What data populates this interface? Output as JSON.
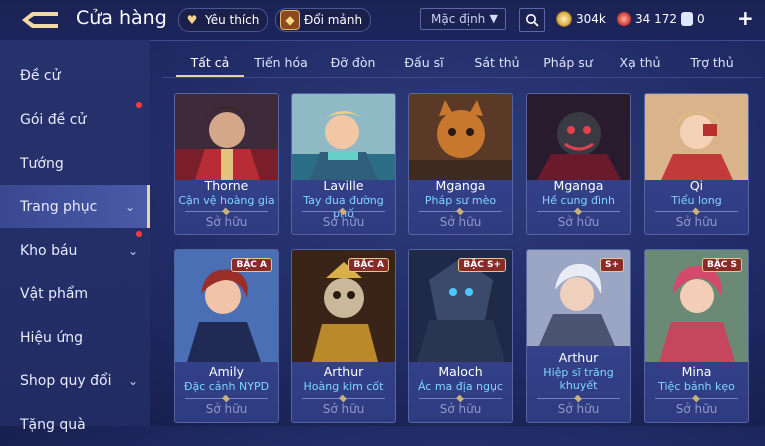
{
  "header": {
    "title": "Cửa hàng",
    "favorites_label": "Yêu thích",
    "exchange_label": "Đổi mảnh",
    "sort_label": "Mặc định",
    "gold": "304k",
    "gems": "34 172",
    "vouchers": "0",
    "plus": "+"
  },
  "sidebar": {
    "items": [
      {
        "label": "Đề cử"
      },
      {
        "label": "Gói đề cử"
      },
      {
        "label": "Tướng"
      },
      {
        "label": "Trang phục"
      },
      {
        "label": "Kho báu"
      },
      {
        "label": "Vật phẩm"
      },
      {
        "label": "Hiệu ứng"
      },
      {
        "label": "Shop quy đổi"
      },
      {
        "label": "Tặng quà"
      }
    ]
  },
  "tabs": [
    "Tất cả",
    "Tiến hóa",
    "Đỡ đòn",
    "Đấu sĩ",
    "Sát thủ",
    "Pháp sư",
    "Xạ thủ",
    "Trợ thủ"
  ],
  "cards": [
    {
      "name": "Thorne",
      "skin": "Cận vệ hoàng gia",
      "status": "Sở hữu",
      "badge": ""
    },
    {
      "name": "Laville",
      "skin": "Tay đua đường phố",
      "status": "Sở hữu",
      "badge": ""
    },
    {
      "name": "Mganga",
      "skin": "Pháp sư mèo",
      "status": "Sở hữu",
      "badge": ""
    },
    {
      "name": "Mganga",
      "skin": "Hề cung đình",
      "status": "Sở hữu",
      "badge": ""
    },
    {
      "name": "Qi",
      "skin": "Tiểu long",
      "status": "Sở hữu",
      "badge": ""
    },
    {
      "name": "Amily",
      "skin": "Đặc cảnh NYPD",
      "status": "Sở hữu",
      "badge": "BẬC A"
    },
    {
      "name": "Arthur",
      "skin": "Hoàng kim cốt",
      "status": "Sở hữu",
      "badge": "BẬC A"
    },
    {
      "name": "Maloch",
      "skin": "Ác ma địa ngục",
      "status": "Sở hữu",
      "badge": "BẬC S+"
    },
    {
      "name": "Arthur",
      "skin": "Hiệp sĩ trăng khuyết",
      "status": "Sở hữu",
      "badge": "S+"
    },
    {
      "name": "Mina",
      "skin": "Tiệc bánh kẹo",
      "status": "Sở hữu",
      "badge": "BẬC S"
    }
  ],
  "colors": {
    "accent_gold": "#e6d3a2",
    "skin_text": "#7fd6ff",
    "notification_dot": "#ff3b3b"
  }
}
